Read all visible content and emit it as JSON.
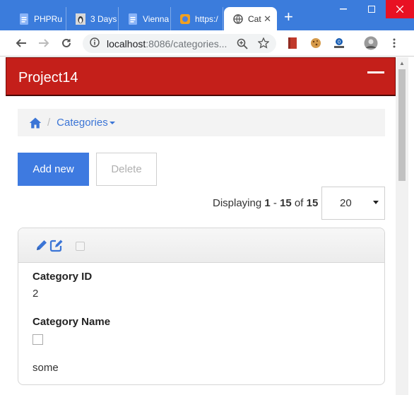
{
  "browser": {
    "tabs": [
      {
        "title": "PHPRu",
        "icon": "docs-icon"
      },
      {
        "title": "3 Days",
        "icon": "penguin-icon"
      },
      {
        "title": "Vienna",
        "icon": "docs-icon"
      },
      {
        "title": "https:/",
        "icon": "site-icon"
      },
      {
        "title": "Cat",
        "icon": "globe-icon",
        "active": true
      }
    ],
    "url_host": "localhost",
    "url_path": ":8086/categories...",
    "accent": "#3b7cdc"
  },
  "app": {
    "brand": "Project14",
    "navbar_color": "#c41f1a"
  },
  "breadcrumb": {
    "sep": "/",
    "current": "Categories"
  },
  "actions": {
    "add_label": "Add new",
    "delete_label": "Delete"
  },
  "pager": {
    "prefix": "Displaying",
    "from": "1",
    "dash": "-",
    "to": "15",
    "of": "of",
    "total": "15",
    "page_size": "20"
  },
  "record": {
    "id_label": "Category ID",
    "id_value": "2",
    "name_label": "Category Name",
    "extra_value": "some"
  }
}
